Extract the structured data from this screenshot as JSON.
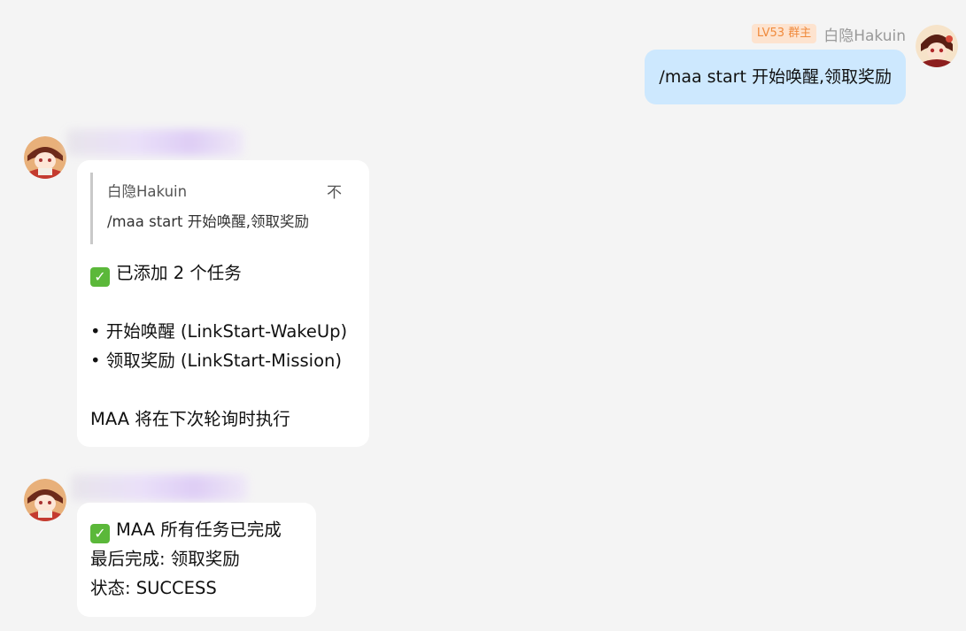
{
  "self_message": {
    "level_badge": "LV53 群主",
    "sender_name": "白隐Hakuin",
    "text": "/maa start 开始唤醒,领取奖励"
  },
  "bot_message_1": {
    "quote_name": "白隐Hakuin",
    "quote_mark": "不",
    "quote_text": "/maa start 开始唤醒,领取奖励",
    "line_added": "已添加 2 个任务",
    "item_1": "• 开始唤醒 (LinkStart-WakeUp)",
    "item_2": "• 领取奖励 (LinkStart-Mission)",
    "footer": "MAA 将在下次轮询时执行"
  },
  "bot_message_2": {
    "line_done": "MAA 所有任务已完成",
    "line_last": "最后完成: 领取奖励",
    "line_status": "状态: SUCCESS"
  },
  "icons": {
    "check": "✓",
    "check_color": "#5bb83a"
  },
  "colors": {
    "self_bubble": "#cde8fe",
    "bot_bubble": "#ffffff",
    "background": "#f4f4f4",
    "level_badge_bg": "#fde3cf",
    "level_badge_text": "#f08a3c"
  }
}
